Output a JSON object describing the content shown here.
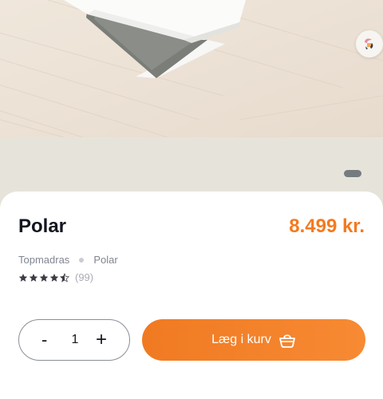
{
  "product": {
    "image_alt": "Polar topmadras",
    "name": "Polar",
    "price": "8.499 kr.",
    "breadcrumb": [
      "Topmadras",
      "Polar"
    ],
    "rating": 4.5,
    "review_count": "(99)"
  },
  "quantity": {
    "decrease_label": "-",
    "value": "1",
    "increase_label": "+"
  },
  "cart_button": {
    "label": "Læg i kurv",
    "icon": "basket-icon"
  },
  "colors": {
    "accent": "#f47a1f",
    "text": "#12161f",
    "muted": "#808690",
    "background": "#e6e4da"
  },
  "carousel": {
    "pages": 1,
    "active": 1
  }
}
